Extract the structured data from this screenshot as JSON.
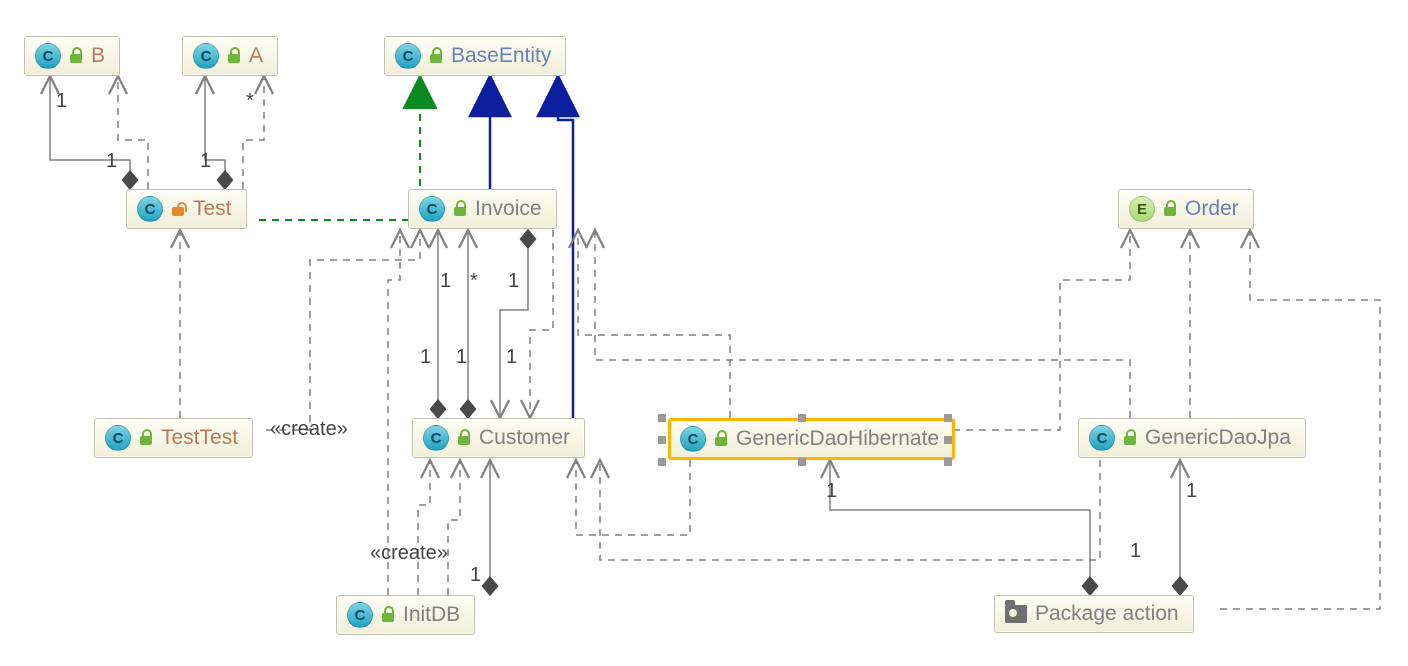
{
  "diagram": {
    "type": "uml-class-diagram",
    "nodes": {
      "b": {
        "kind": "C",
        "access": "public",
        "name": "B",
        "nameColor": "brown"
      },
      "a": {
        "kind": "C",
        "access": "public",
        "name": "A",
        "nameColor": "brown"
      },
      "baseEntity": {
        "kind": "C",
        "access": "public",
        "name": "BaseEntity",
        "nameColor": "blue"
      },
      "test": {
        "kind": "C",
        "access": "private",
        "name": "Test",
        "nameColor": "brown"
      },
      "invoice": {
        "kind": "C",
        "access": "public",
        "name": "Invoice",
        "nameColor": "grey"
      },
      "order": {
        "kind": "E",
        "access": "public",
        "name": "Order",
        "nameColor": "blue"
      },
      "testTest": {
        "kind": "C",
        "access": "public",
        "name": "TestTest",
        "nameColor": "brown"
      },
      "customer": {
        "kind": "C",
        "access": "public",
        "name": "Customer",
        "nameColor": "grey"
      },
      "genericDaoHibernate": {
        "kind": "C",
        "access": "public",
        "name": "GenericDaoHibernate",
        "nameColor": "grey",
        "selected": true
      },
      "genericDaoJpa": {
        "kind": "C",
        "access": "public",
        "name": "GenericDaoJpa",
        "nameColor": "grey"
      },
      "initDB": {
        "kind": "C",
        "access": "public",
        "name": "InitDB",
        "nameColor": "grey"
      },
      "packageAction": {
        "kind": "package",
        "name": "Package action",
        "nameColor": "grey"
      }
    },
    "labels": {
      "create1": "«create»",
      "create2": "«create»",
      "m1": "1",
      "m2": "1",
      "m3": "1",
      "m4": "*",
      "m5": "1",
      "m6": "*",
      "m7": "1",
      "m8": "1",
      "m9": "1",
      "m10": "1",
      "m11": "1",
      "m12": "1",
      "m13": "1"
    },
    "edges": [
      {
        "from": "test",
        "to": "b",
        "kind": "composition",
        "mult_from": "1",
        "mult_to": "1"
      },
      {
        "from": "test",
        "to": "a",
        "kind": "composition",
        "mult_from": "1",
        "mult_to": "*"
      },
      {
        "from": "testTest",
        "to": "test",
        "kind": "dependency"
      },
      {
        "from": "test",
        "to": "baseEntity",
        "kind": "realization-green",
        "dashed": true
      },
      {
        "from": "invoice",
        "to": "baseEntity",
        "kind": "generalization-navy"
      },
      {
        "from": "customer",
        "to": "baseEntity",
        "kind": "generalization-navy"
      },
      {
        "from": "customer",
        "to": "invoice",
        "kind": "composition",
        "mult_from": "1",
        "mult_to": "1"
      },
      {
        "from": "customer",
        "to": "invoice",
        "kind": "composition",
        "mult_from": "1",
        "mult_to": "*"
      },
      {
        "from": "invoice",
        "to": "customer",
        "kind": "composition",
        "mult_from": "1",
        "mult_to": "1"
      },
      {
        "from": "invoice",
        "to": "customer",
        "kind": "dependency"
      },
      {
        "from": "testTest",
        "to": "invoice",
        "kind": "dependency"
      },
      {
        "from": "initDB",
        "to": "invoice",
        "kind": "dependency",
        "label": "«create»"
      },
      {
        "from": "initDB",
        "to": "customer",
        "kind": "dependency",
        "label": "«create»"
      },
      {
        "from": "initDB",
        "to": "customer",
        "kind": "composition",
        "mult_to": "1"
      },
      {
        "from": "genericDaoHibernate",
        "to": "customer",
        "kind": "dependency"
      },
      {
        "from": "genericDaoHibernate",
        "to": "invoice",
        "kind": "dependency"
      },
      {
        "from": "genericDaoHibernate",
        "to": "order",
        "kind": "dependency"
      },
      {
        "from": "genericDaoJpa",
        "to": "customer",
        "kind": "dependency"
      },
      {
        "from": "genericDaoJpa",
        "to": "invoice",
        "kind": "dependency"
      },
      {
        "from": "genericDaoJpa",
        "to": "order",
        "kind": "dependency"
      },
      {
        "from": "packageAction",
        "to": "genericDaoHibernate",
        "kind": "composition",
        "mult_to": "1"
      },
      {
        "from": "packageAction",
        "to": "genericDaoJpa",
        "kind": "composition",
        "mult_to": "1"
      },
      {
        "from": "packageAction",
        "to": "order",
        "kind": "dependency"
      }
    ]
  }
}
